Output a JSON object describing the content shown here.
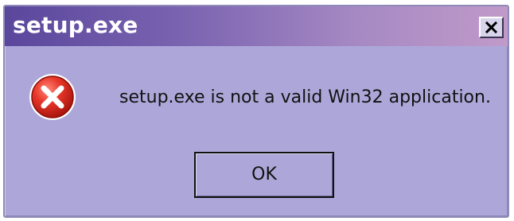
{
  "window": {
    "title": "setup.exe",
    "close_symbol": "✕"
  },
  "icon": {
    "name": "error-icon",
    "color": "#d6261c"
  },
  "message": {
    "text": "setup.exe is not a valid Win32 application."
  },
  "buttons": {
    "ok_label": "OK"
  },
  "colors": {
    "dialog_bg": "#aca7d8",
    "title_gradient_start": "#5a479c",
    "title_gradient_end": "#c09ac9"
  }
}
